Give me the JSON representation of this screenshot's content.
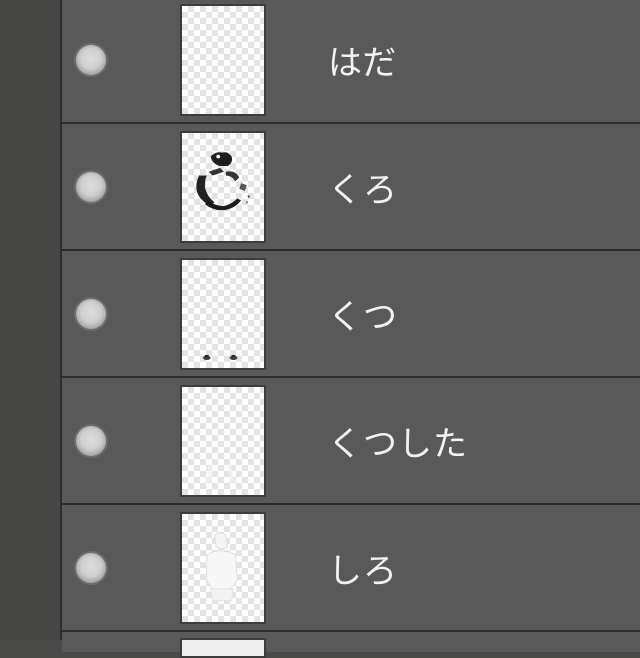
{
  "layers_panel": {
    "layers": [
      {
        "name": "はだ",
        "visible_icon": "visibility-eye-dot-icon",
        "thumb": "skin-layer-thumbnail"
      },
      {
        "name": "くろ",
        "visible_icon": "visibility-eye-dot-icon",
        "thumb": "black-layer-thumbnail"
      },
      {
        "name": "くつ",
        "visible_icon": "visibility-eye-dot-icon",
        "thumb": "shoes-layer-thumbnail"
      },
      {
        "name": "くつした",
        "visible_icon": "visibility-eye-dot-icon",
        "thumb": "socks-layer-thumbnail"
      },
      {
        "name": "しろ",
        "visible_icon": "visibility-eye-dot-icon",
        "thumb": "white-layer-thumbnail"
      }
    ]
  }
}
